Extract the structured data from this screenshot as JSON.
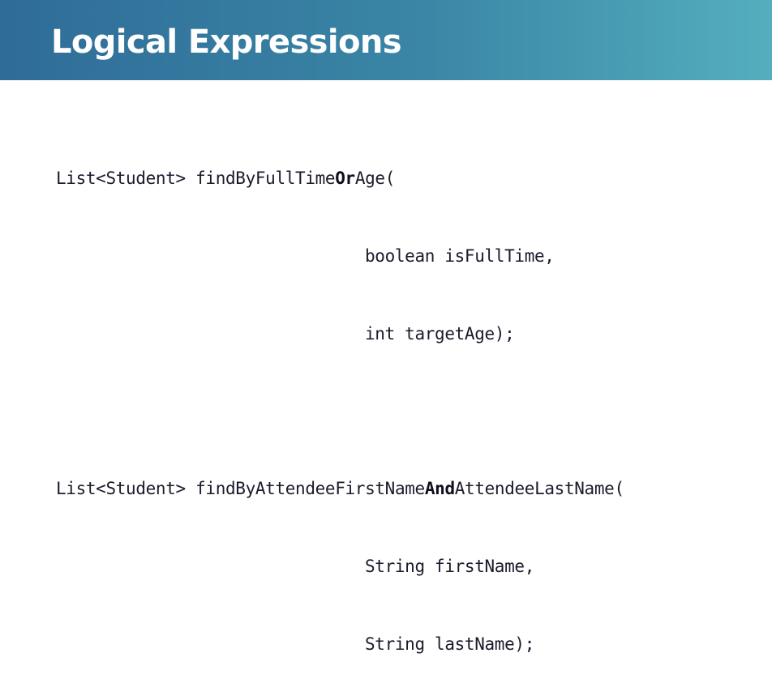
{
  "slide": {
    "title": "Logical Expressions"
  },
  "code": {
    "method1": {
      "return_type": "List<Student>",
      "name_prefix": "findByFullTime",
      "keyword": "Or",
      "name_suffix": "Age",
      "open_paren": "(",
      "param1": "boolean isFullTime,",
      "param2": "int targetAge);"
    },
    "method2": {
      "return_type": "List<Student>",
      "name_prefix": "findByAttendeeFirstName",
      "keyword": "And",
      "name_suffix": "AttendeeLastName",
      "open_paren": "(",
      "param1": "String firstName,",
      "param2": "String lastName);"
    }
  },
  "colors": {
    "header_start": "#2f6c98",
    "header_end": "#54aebd",
    "title": "#ffffff",
    "code_text": "#1b1b2d"
  }
}
